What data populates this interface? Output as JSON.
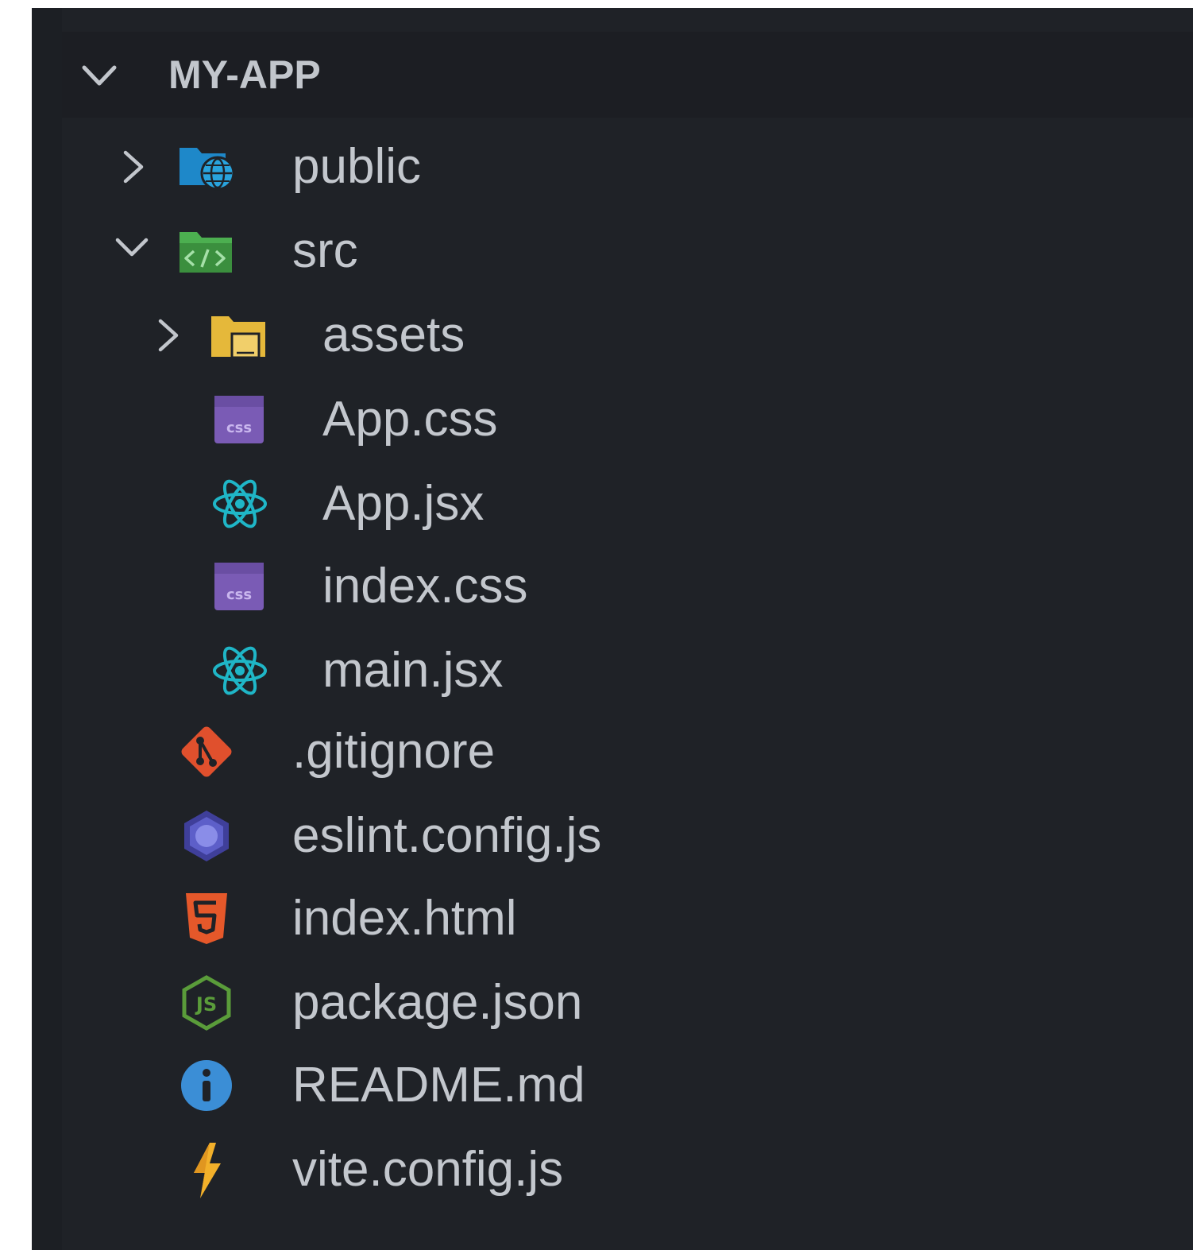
{
  "explorer": {
    "section_title": "MY-APP",
    "items": [
      {
        "label": "public",
        "icon": "public-folder-icon",
        "kind": "folder",
        "expanded": false,
        "depth": 0
      },
      {
        "label": "src",
        "icon": "src-folder-icon",
        "kind": "folder",
        "expanded": true,
        "depth": 0
      },
      {
        "label": "assets",
        "icon": "assets-folder-icon",
        "kind": "folder",
        "expanded": false,
        "depth": 1
      },
      {
        "label": "App.css",
        "icon": "css-file-icon",
        "kind": "file",
        "depth": 1
      },
      {
        "label": "App.jsx",
        "icon": "react-file-icon",
        "kind": "file",
        "depth": 1
      },
      {
        "label": "index.css",
        "icon": "css-file-icon",
        "kind": "file",
        "depth": 1
      },
      {
        "label": "main.jsx",
        "icon": "react-file-icon",
        "kind": "file",
        "depth": 1
      },
      {
        "label": ".gitignore",
        "icon": "git-file-icon",
        "kind": "file",
        "depth": 0
      },
      {
        "label": "eslint.config.js",
        "icon": "eslint-file-icon",
        "kind": "file",
        "depth": 0
      },
      {
        "label": "index.html",
        "icon": "html5-file-icon",
        "kind": "file",
        "depth": 0
      },
      {
        "label": "package.json",
        "icon": "nodejs-file-icon",
        "kind": "file",
        "depth": 0
      },
      {
        "label": "README.md",
        "icon": "info-file-icon",
        "kind": "file",
        "depth": 0
      },
      {
        "label": "vite.config.js",
        "icon": "vite-file-icon",
        "kind": "file",
        "depth": 0
      }
    ]
  },
  "colors": {
    "panel_bg": "#1f2227",
    "text": "#c3c7cd",
    "folder_blue": "#1e88c9",
    "folder_green": "#4caf50",
    "folder_yellow": "#e5b83a",
    "css_purple": "#7a5bb5",
    "react_cyan": "#1fb6c7",
    "git_red": "#e0502d",
    "eslint_purple": "#5d5fc9",
    "html_orange": "#e5582a",
    "node_green": "#5a9c3a",
    "info_blue": "#3b8ed6",
    "vite_yellow": "#f2b02a"
  }
}
